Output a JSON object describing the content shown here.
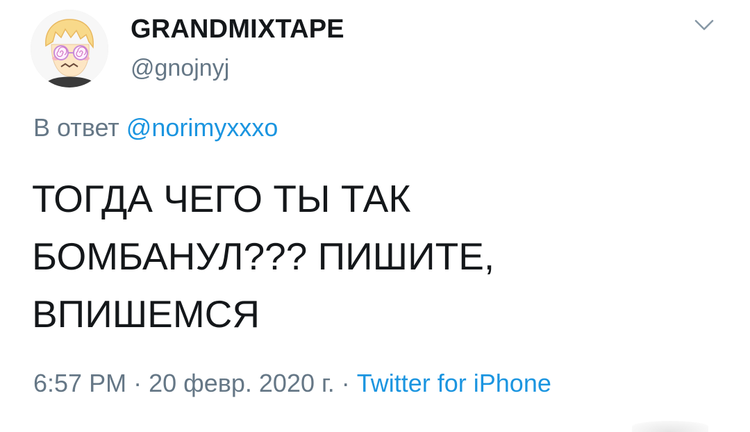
{
  "author": {
    "display_name": "GRANDMIXTAPE",
    "handle": "@gnojnyj",
    "avatar_icon": "cartoon-avatar-icon"
  },
  "header": {
    "menu_icon": "chevron-down-icon"
  },
  "reply": {
    "prefix": "В ответ",
    "mention": "@norimyxxxo"
  },
  "tweet": {
    "lines": [
      "ТОГДА ЧЕГО ТЫ ТАК",
      "БОМБАНУЛ??? ПИШИТЕ,",
      "ВПИШЕМСЯ"
    ]
  },
  "meta": {
    "time": "6:57 PM",
    "separator": "·",
    "date": "20 февр. 2020 г.",
    "source": "Twitter for iPhone"
  },
  "colors": {
    "text": "#14171a",
    "secondary": "#657786",
    "link": "#1b95e0",
    "background": "#ffffff"
  }
}
